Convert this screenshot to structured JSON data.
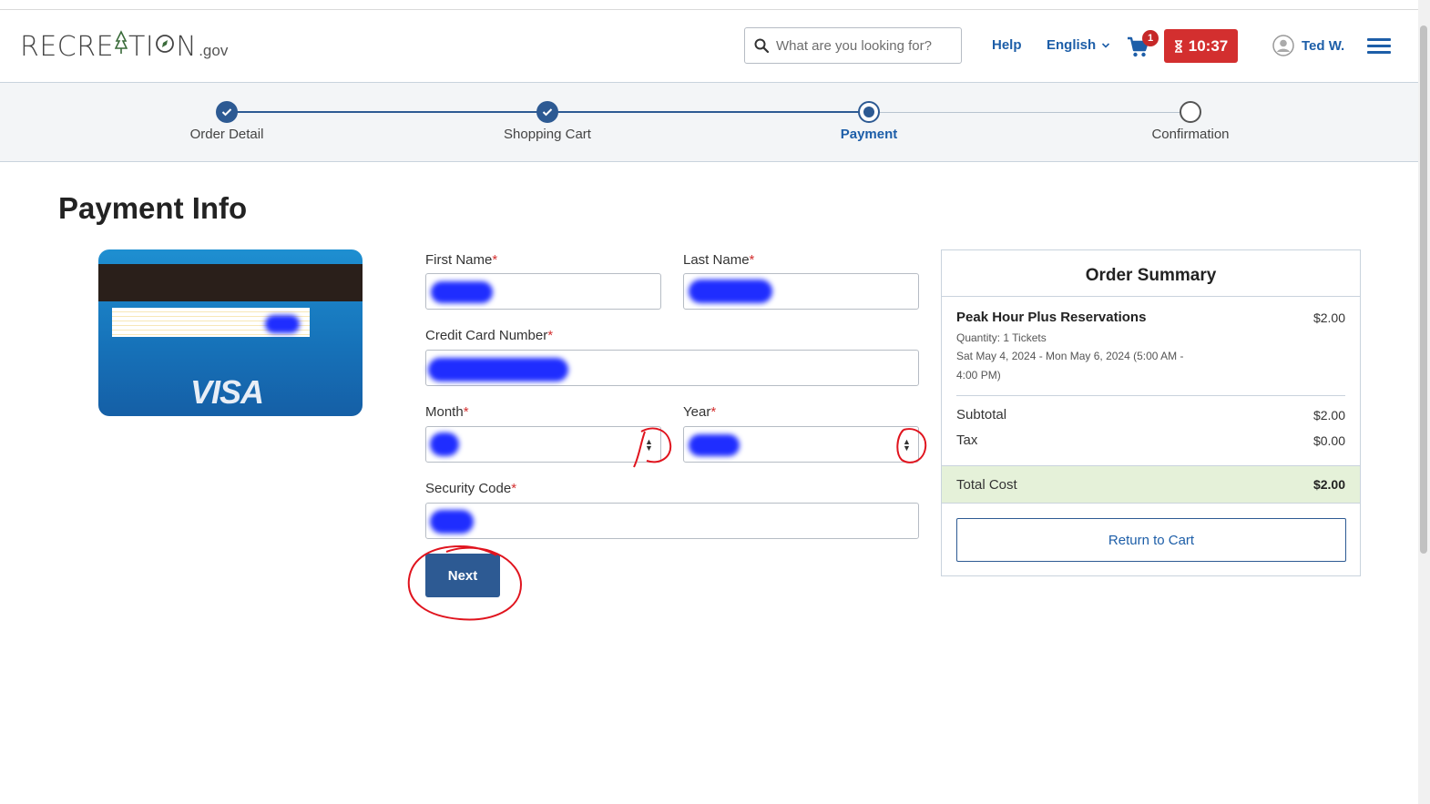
{
  "header": {
    "logo_main": "RECRE",
    "logo_mid": "TI",
    "logo_end": "N",
    "logo_suffix": ".gov",
    "search_placeholder": "What are you looking for?",
    "help": "Help",
    "language": "English",
    "cart_count": "1",
    "timer": "10:37",
    "user": "Ted W."
  },
  "progress": {
    "steps": [
      {
        "label": "Order Detail",
        "state": "done"
      },
      {
        "label": "Shopping Cart",
        "state": "done"
      },
      {
        "label": "Payment",
        "state": "current"
      },
      {
        "label": "Confirmation",
        "state": "todo"
      }
    ]
  },
  "page": {
    "title": "Payment Info"
  },
  "card": {
    "brand": "VISA"
  },
  "form": {
    "first_name_label": "First Name",
    "last_name_label": "Last Name",
    "card_number_label": "Credit Card Number",
    "month_label": "Month",
    "year_label": "Year",
    "security_code_label": "Security Code",
    "required_mark": "*",
    "next": "Next"
  },
  "summary": {
    "title": "Order Summary",
    "item_name": "Peak Hour Plus Reservations",
    "item_price": "$2.00",
    "quantity": "Quantity: 1 Tickets",
    "dates_line1": "Sat May 4, 2024 - Mon May 6, 2024 (5:00 AM -",
    "dates_line2": "4:00 PM)",
    "subtotal_label": "Subtotal",
    "subtotal": "$2.00",
    "tax_label": "Tax",
    "tax": "$0.00",
    "total_label": "Total Cost",
    "total": "$2.00",
    "return": "Return to Cart"
  },
  "colors": {
    "brand_blue": "#2d5a93",
    "link_blue": "#1d5ea8",
    "timer_red": "#d32f2f",
    "total_bg": "#e5f1d9",
    "annotation_red": "#e0141e",
    "redaction_blue": "#1f2dff"
  }
}
